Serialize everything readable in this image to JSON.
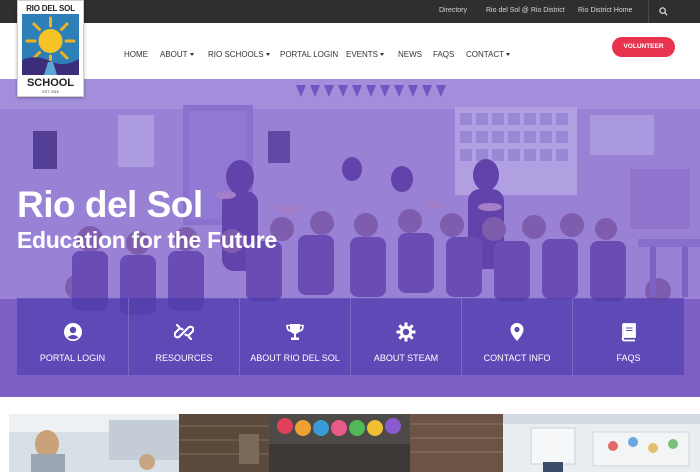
{
  "utility_nav": {
    "links": [
      "Directory",
      "Rio del Sol @ Rio District",
      "Rio District Home"
    ],
    "search_icon": "search-icon"
  },
  "logo": {
    "top_text": "RIO DEL SOL",
    "bottom_text": "SCHOOL",
    "established": "EST. 2018"
  },
  "main_nav": {
    "items": [
      {
        "label": "HOME",
        "dropdown": false
      },
      {
        "label": "ABOUT",
        "dropdown": true
      },
      {
        "label": "RIO SCHOOLS",
        "dropdown": true
      },
      {
        "label": "PORTAL LOGIN",
        "dropdown": false
      },
      {
        "label": "EVENTS",
        "dropdown": true
      },
      {
        "label": "NEWS",
        "dropdown": false
      },
      {
        "label": "FAQS",
        "dropdown": false
      },
      {
        "label": "CONTACT",
        "dropdown": true
      }
    ],
    "cta_label": "VOLUNTEER"
  },
  "hero": {
    "title": "Rio del Sol",
    "subtitle": "Education for the Future",
    "overlay_color": "#6a4ac8"
  },
  "quick_links": [
    {
      "label": "PORTAL LOGIN",
      "icon": "user-circle-icon"
    },
    {
      "label": "RESOURCES",
      "icon": "chain-link-icon"
    },
    {
      "label": "ABOUT RIO DEL SOL",
      "icon": "trophy-icon"
    },
    {
      "label": "ABOUT STEAM",
      "icon": "gear-icon"
    },
    {
      "label": "CONTACT INFO",
      "icon": "map-pin-icon"
    },
    {
      "label": "FAQS",
      "icon": "book-icon"
    }
  ],
  "theme": {
    "topbar_bg": "#2f2f31",
    "cta_color": "#e8334f",
    "quick_bar_bg": "#4637aa"
  }
}
